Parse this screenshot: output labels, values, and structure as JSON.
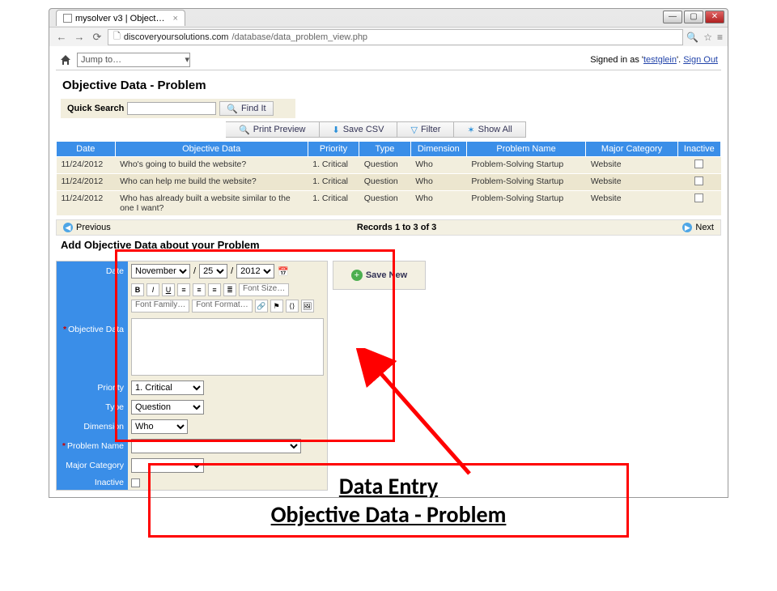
{
  "browser": {
    "tab_title": "mysolver v3 | Object…",
    "url_host": "discoveryoursolutions.com",
    "url_path": "/database/data_problem_view.php"
  },
  "app_bar": {
    "jump_label": "Jump to…",
    "signed_in_prefix": "Signed in as '",
    "username": "testglein",
    "signed_in_suffix": "'. ",
    "signout": "Sign Out"
  },
  "page_title": "Objective Data - Problem",
  "quick_search": {
    "label": "Quick Search",
    "find_label": "Find It"
  },
  "toolbar": {
    "print": "Print Preview",
    "save_csv": "Save CSV",
    "filter": "Filter",
    "show_all": "Show All"
  },
  "columns": [
    "Date",
    "Objective Data",
    "Priority",
    "Type",
    "Dimension",
    "Problem Name",
    "Major Category",
    "Inactive"
  ],
  "rows": [
    {
      "date": "11/24/2012",
      "data": "Who's going to build the website?",
      "priority": "1. Critical",
      "type": "Question",
      "dimension": "Who",
      "problem": "Problem-Solving Startup",
      "major": "Website"
    },
    {
      "date": "11/24/2012",
      "data": "Who can help me build the website?",
      "priority": "1. Critical",
      "type": "Question",
      "dimension": "Who",
      "problem": "Problem-Solving Startup",
      "major": "Website"
    },
    {
      "date": "11/24/2012",
      "data": "Who has already built a website similar to the one I want?",
      "priority": "1. Critical",
      "type": "Question",
      "dimension": "Who",
      "problem": "Problem-Solving Startup",
      "major": "Website"
    }
  ],
  "pager": {
    "prev": "Previous",
    "next": "Next",
    "records": "Records 1 to 3 of 3"
  },
  "form": {
    "title": "Add Objective Data about your Problem",
    "labels": {
      "date": "Date",
      "objective_data": "Objective Data",
      "priority": "Priority",
      "type": "Type",
      "dimension": "Dimension",
      "problem_name": "Problem Name",
      "major_category": "Major Category",
      "inactive": "Inactive"
    },
    "date": {
      "month": "November",
      "day": "25",
      "year": "2012"
    },
    "rte": {
      "font_family": "Font Family…",
      "font_format": "Font Format…",
      "font_size": "Font Size…"
    },
    "values": {
      "priority": "1. Critical",
      "type": "Question",
      "dimension": "Who"
    },
    "save_new": "Save New"
  },
  "annotation": {
    "line1": "Data Entry",
    "line2": "Objective Data - Problem"
  }
}
